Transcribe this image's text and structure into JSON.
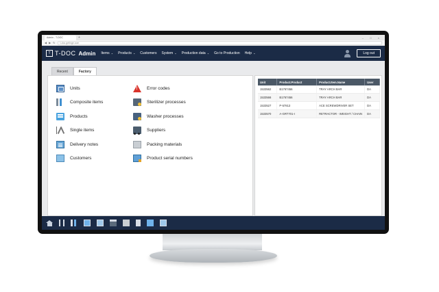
{
  "browser": {
    "tab_title": "Admin - T-DOC",
    "tab_add": "+",
    "url": "t-doc.getinge.com",
    "window_controls": "– □ ×"
  },
  "nav": {
    "logo_letters": "T",
    "brand": "T-DOC",
    "brand_admin": "Admin",
    "items": [
      {
        "label": "Items",
        "caret": true
      },
      {
        "label": "Products",
        "caret": true
      },
      {
        "label": "Customers",
        "caret": false
      },
      {
        "label": "System",
        "caret": true
      },
      {
        "label": "Production data",
        "caret": true
      },
      {
        "label": "Go to Production",
        "caret": false
      },
      {
        "label": "Help",
        "caret": true
      }
    ],
    "logout_label": "Log out"
  },
  "tabs": {
    "recent": "Recent",
    "factory": "Factory"
  },
  "menu": {
    "left": [
      {
        "label": "Units",
        "icon": "units-icon"
      },
      {
        "label": "Composite items",
        "icon": "composite-items-icon"
      },
      {
        "label": "Products",
        "icon": "products-icon"
      },
      {
        "label": "Single items",
        "icon": "single-items-icon"
      },
      {
        "label": "Delivery notes",
        "icon": "delivery-notes-icon"
      },
      {
        "label": "Customers",
        "icon": "customers-icon"
      }
    ],
    "right": [
      {
        "label": "Error codes",
        "icon": "error-codes-icon"
      },
      {
        "label": "Sterilizer processes",
        "icon": "sterilizer-icon"
      },
      {
        "label": "Washer processes",
        "icon": "washer-icon"
      },
      {
        "label": "Suppliers",
        "icon": "suppliers-icon"
      },
      {
        "label": "Packing materials",
        "icon": "packing-materials-icon"
      },
      {
        "label": "Product serial numbers",
        "icon": "serial-numbers-icon"
      }
    ]
  },
  "table": {
    "headers": [
      "Unit",
      "Product.Product",
      "Product.Item.Name",
      "User"
    ],
    "rows": [
      [
        "1533562",
        "B1767456",
        "TRAY ARCH BAR",
        "DA"
      ],
      [
        "1533566",
        "B1767456",
        "TRAY ARCH BAR",
        "DA"
      ],
      [
        "1533527",
        "P-57813",
        "ACE SCREWDRIVER SET",
        "DA"
      ],
      [
        "1533570",
        "A-GRT701-I",
        "RETRACTOR - WEIGHT / CHAIN",
        "DA"
      ]
    ]
  },
  "colors": {
    "navbar": "#1b2b46",
    "table_header": "#4b5866",
    "accent_blue": "#4aa3df",
    "error_red": "#d9342b"
  }
}
